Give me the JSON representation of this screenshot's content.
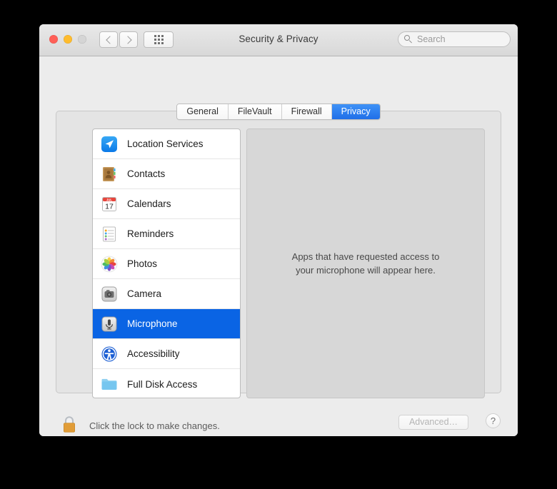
{
  "window": {
    "title": "Security & Privacy",
    "traffic_lights": [
      "close",
      "minimize",
      "zoom"
    ],
    "nav": {
      "back_icon": "chevron-left-icon",
      "forward_icon": "chevron-right-icon",
      "grid_icon": "show-all-grid-icon"
    }
  },
  "search": {
    "placeholder": "Search",
    "value": "",
    "icon": "search-icon"
  },
  "tabs": [
    {
      "label": "General",
      "active": false
    },
    {
      "label": "FileVault",
      "active": false
    },
    {
      "label": "Firewall",
      "active": false
    },
    {
      "label": "Privacy",
      "active": true
    }
  ],
  "services": [
    {
      "label": "Location Services",
      "icon": "location-services-icon",
      "selected": false
    },
    {
      "label": "Contacts",
      "icon": "contacts-icon",
      "selected": false
    },
    {
      "label": "Calendars",
      "icon": "calendars-icon",
      "selected": false
    },
    {
      "label": "Reminders",
      "icon": "reminders-icon",
      "selected": false
    },
    {
      "label": "Photos",
      "icon": "photos-icon",
      "selected": false
    },
    {
      "label": "Camera",
      "icon": "camera-icon",
      "selected": false
    },
    {
      "label": "Microphone",
      "icon": "microphone-icon",
      "selected": true
    },
    {
      "label": "Accessibility",
      "icon": "accessibility-icon",
      "selected": false
    },
    {
      "label": "Full Disk Access",
      "icon": "full-disk-access-icon",
      "selected": false
    }
  ],
  "right_pane": {
    "empty_message": "Apps that have requested access to your microphone will appear here."
  },
  "footer": {
    "lock_icon": "locked-padlock-icon",
    "lock_text": "Click the lock to make changes.",
    "advanced_label": "Advanced…",
    "help_label": "?"
  },
  "calendar_icon": {
    "month": "JUL",
    "day": "17"
  },
  "colors": {
    "accent_blue": "#0a64e4",
    "tab_blue": "#2f80ef",
    "window_bg": "#ececec",
    "pane_bg": "#d7d7d7",
    "content_bg": "#e4e4e4",
    "lock_gold": "#e8a33d"
  }
}
